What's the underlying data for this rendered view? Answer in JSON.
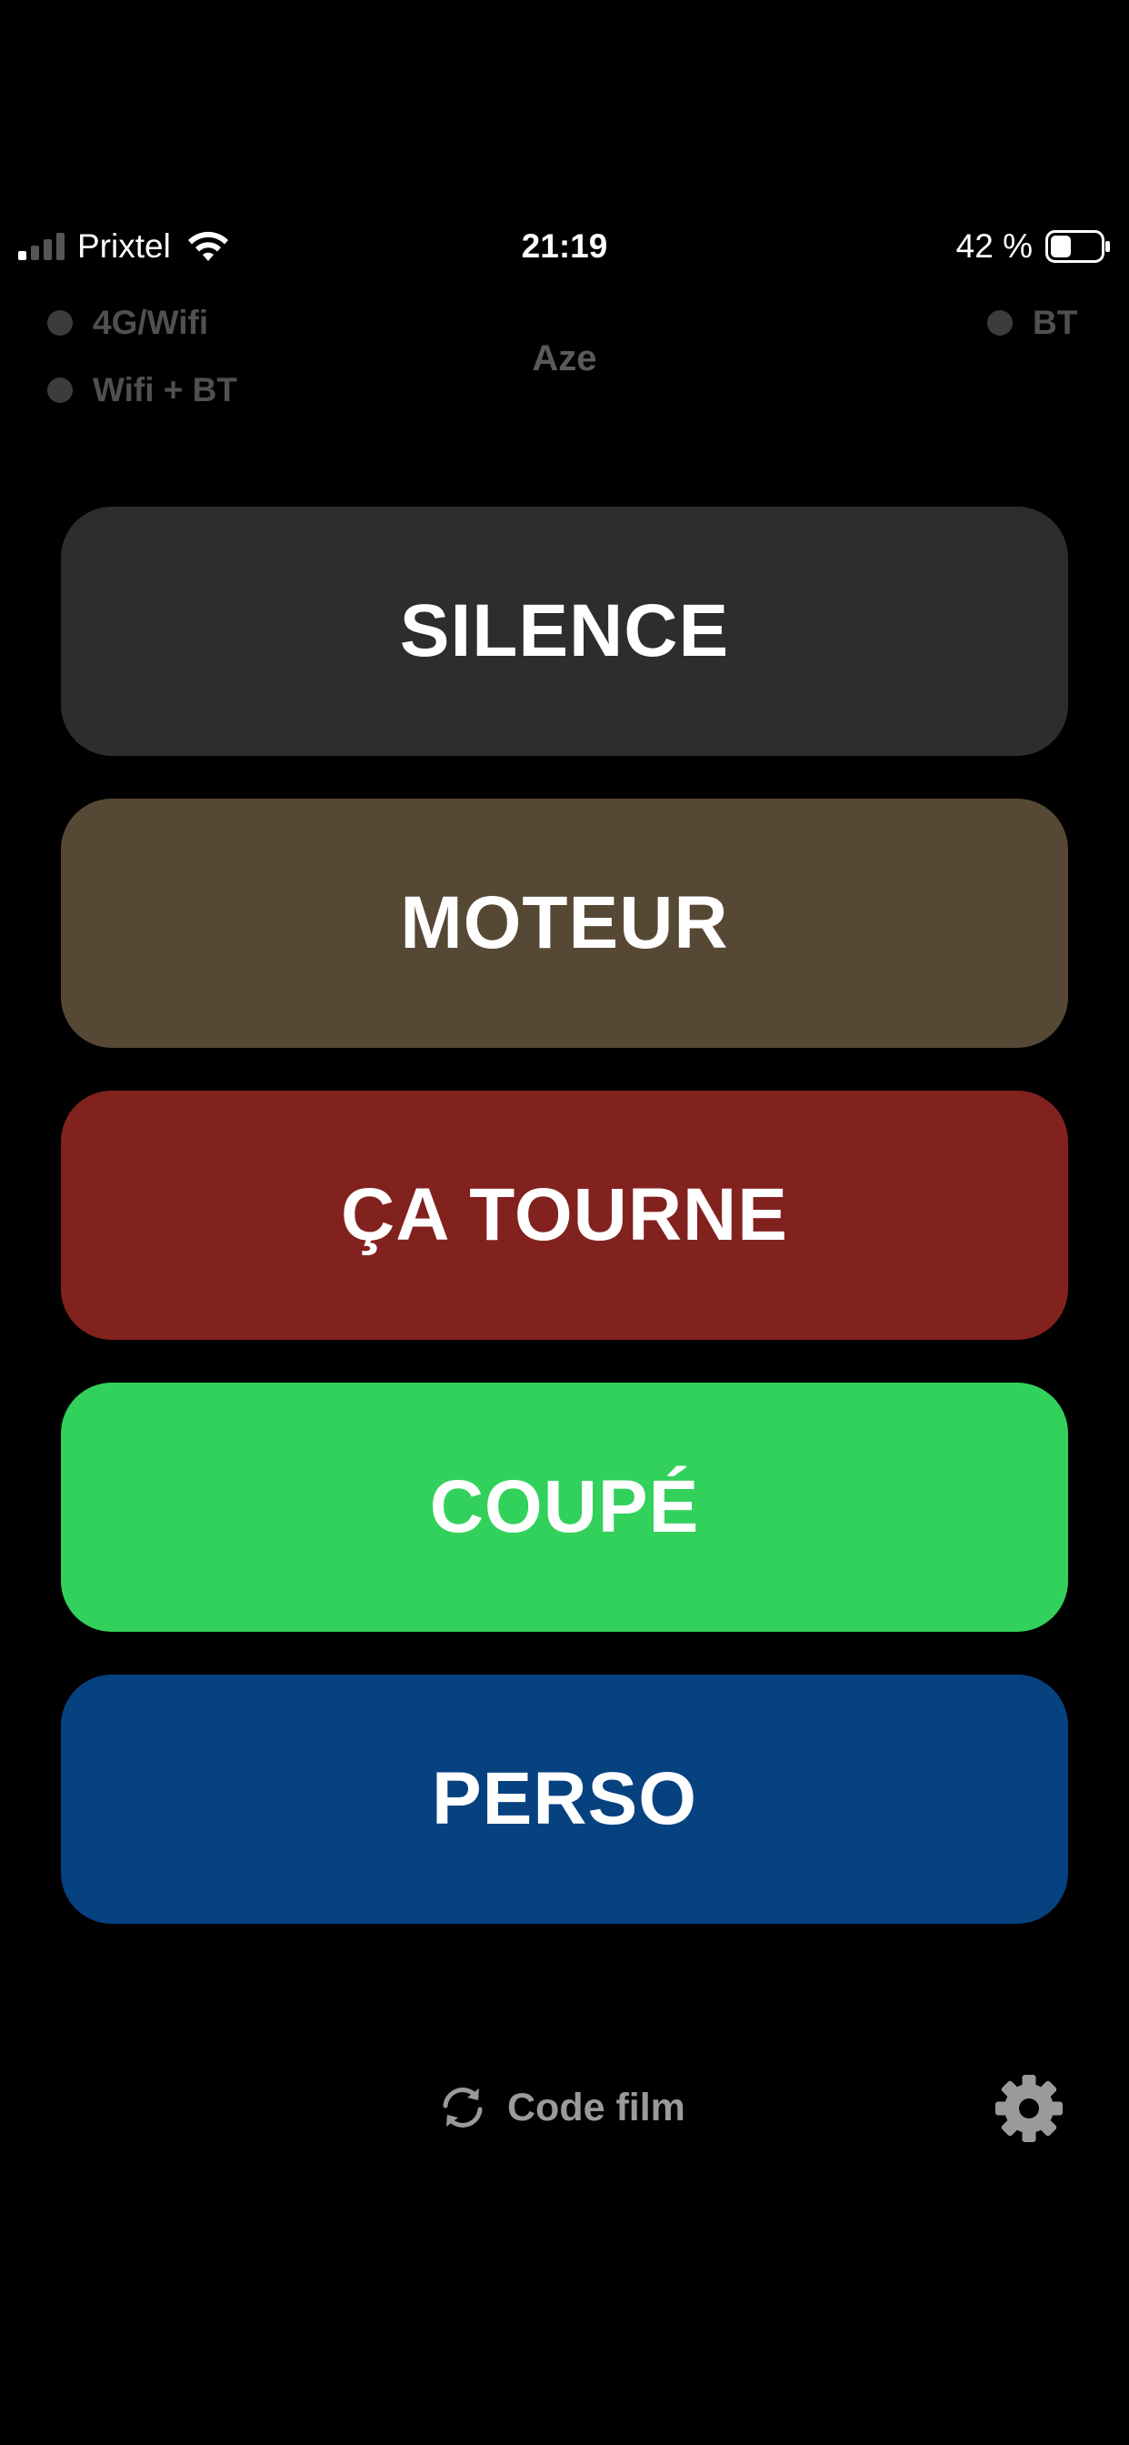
{
  "status_bar": {
    "carrier": "Prixtel",
    "time": "21:19",
    "battery": "42 %",
    "signal_bars_active": 1,
    "signal_bars_total": 4,
    "battery_level": 0.42
  },
  "connection": {
    "mode_4g_wifi": "4G/Wifi",
    "mode_wifi_bt": "Wifi + BT",
    "mode_bt": "BT",
    "device_name": "Aze"
  },
  "buttons": [
    {
      "label": "SILENCE",
      "color": "#2d2d2d"
    },
    {
      "label": "MOTEUR",
      "color": "#574835"
    },
    {
      "label": "ÇA TOURNE",
      "color": "#82221f"
    },
    {
      "label": "COUPÉ",
      "color": "#32d15b"
    },
    {
      "label": "PERSO",
      "color": "#064180"
    }
  ],
  "footer": {
    "code_film_label": "Code film",
    "refresh_icon": "refresh-icon",
    "settings_icon": "gear-icon"
  },
  "colors": {
    "background": "#000000",
    "muted_text": "#505050",
    "footer_text": "#9a9a9a",
    "icon_gray": "#9a9a9a"
  }
}
